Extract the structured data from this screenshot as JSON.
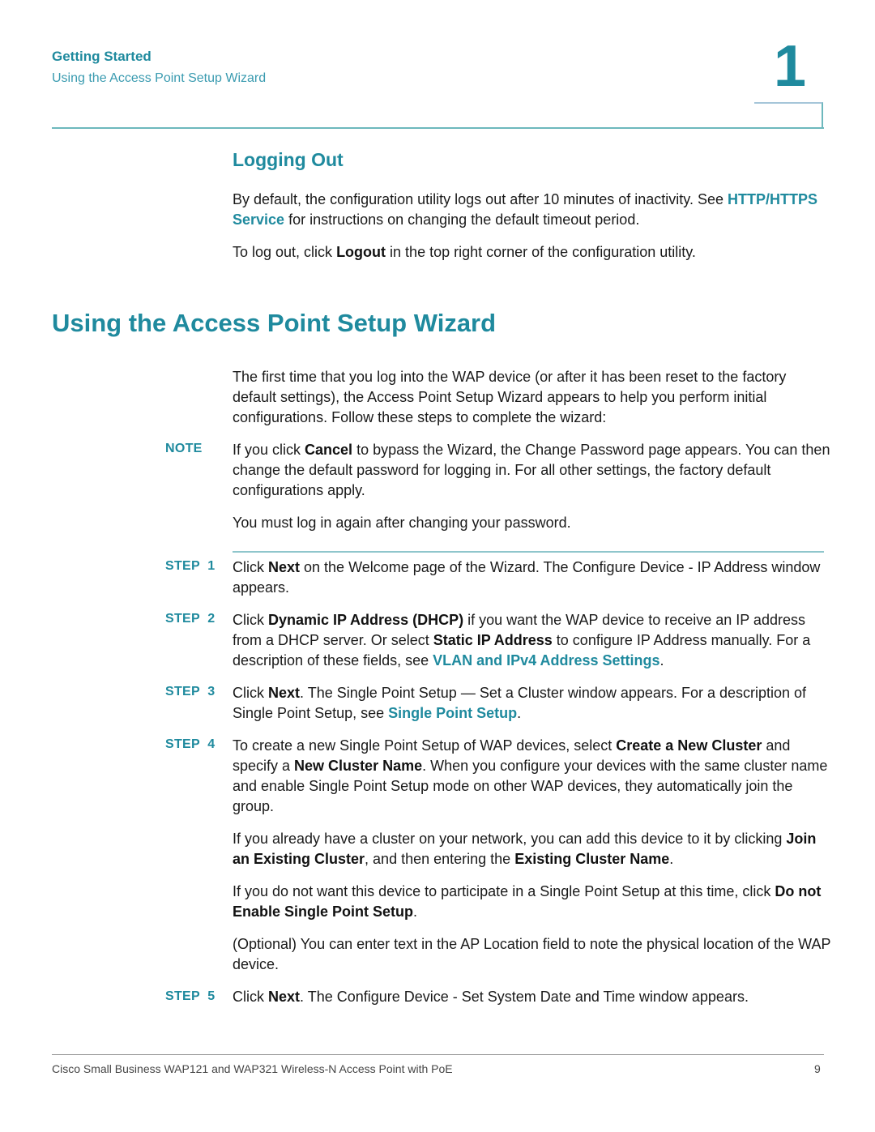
{
  "header": {
    "chapter_title": "Getting Started",
    "chapter_subtitle": "Using the Access Point Setup Wizard",
    "chapter_number": "1"
  },
  "logging_out": {
    "heading": "Logging Out",
    "p1_a": "By default, the configuration utility logs out after 10 minutes of inactivity. See ",
    "p1_link": "HTTP/HTTPS Service",
    "p1_b": " for instructions on changing the default timeout period.",
    "p2_a": "To log out, click ",
    "p2_bold": "Logout",
    "p2_b": " in the top right corner of the configuration utility."
  },
  "wizard": {
    "heading": "Using the Access Point Setup Wizard",
    "intro": "The first time that you log into the WAP device (or after it has been reset to the factory default settings), the Access Point Setup Wizard appears to help you perform initial configurations. Follow these steps to complete the wizard:",
    "note_label": "NOTE",
    "note_a": "If you click ",
    "note_bold": "Cancel",
    "note_b": " to bypass the Wizard, the Change Password page appears. You can then change the default password for logging in. For all other settings, the factory default configurations apply.",
    "note_p2": "You must log in again after changing your password.",
    "steps": [
      {
        "label": "STEP  1",
        "a": "Click ",
        "b1": "Next",
        "c": " on the Welcome page of the Wizard. The Configure Device - IP Address window appears."
      },
      {
        "label": "STEP  2",
        "a": "Click ",
        "b1": "Dynamic IP Address (DHCP)",
        "c": " if you want the WAP device to receive an IP address from a DHCP server. Or select ",
        "b2": "Static IP Address",
        "d": " to configure IP Address manually. For a description of these fields, see ",
        "link": "VLAN and IPv4 Address Settings",
        "e": "."
      },
      {
        "label": "STEP  3",
        "a": "Click ",
        "b1": "Next",
        "c": ". The Single Point Setup — Set a Cluster window appears. For a description of Single Point Setup, see ",
        "link": "Single Point Setup",
        "e": "."
      },
      {
        "label": "STEP  4",
        "a": "To create a new Single Point Setup of WAP devices, select ",
        "b1": "Create a New Cluster",
        "c": " and specify a ",
        "b2": "New Cluster Name",
        "d": ". When you configure your devices with the same cluster name and enable Single Point Setup mode on other WAP devices, they automatically join the group.",
        "p2_a": "If you already have a cluster on your network, you can add this device to it by clicking ",
        "p2_b1": "Join an Existing Cluster",
        "p2_c": ", and then entering the ",
        "p2_b2": "Existing Cluster Name",
        "p2_d": ".",
        "p3_a": "If you do not want this device to participate in a Single Point Setup at this time, click ",
        "p3_b": "Do not Enable Single Point Setup",
        "p3_c": ".",
        "p4": "(Optional) You can enter text in the AP Location field to note the physical location of the WAP device."
      },
      {
        "label": "STEP  5",
        "a": "Click ",
        "b1": "Next",
        "c": ". The Configure Device - Set System Date and Time window appears."
      }
    ]
  },
  "footer": {
    "text": "Cisco Small Business WAP121 and WAP321 Wireless-N Access Point with PoE",
    "page_number": "9"
  }
}
